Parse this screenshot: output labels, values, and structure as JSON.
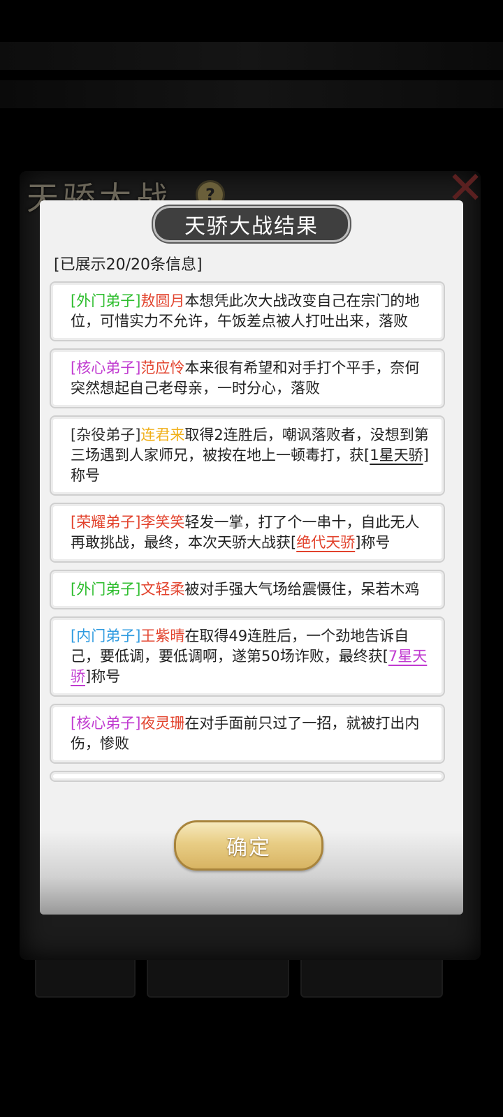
{
  "background": {
    "panel_title": "天骄大战"
  },
  "dialog": {
    "title": "天骄大战结果",
    "info_count": "[已展示20/20条信息]",
    "confirm_label": "确定"
  },
  "colors": {
    "outer_disciple": "#2dbd2d",
    "core_disciple": "#c03ad0",
    "servant_disciple": "#333333",
    "glory_disciple": "#e2422c",
    "inner_disciple": "#2f9be0",
    "name_red": "#e2422c",
    "name_yellow": "#f0b01a",
    "title_purple": "#c03ad0",
    "title_red": "#e2422c",
    "title_dark": "#222222"
  },
  "results": [
    {
      "rank": "[外门弟子]",
      "rank_color": "#2dbd2d",
      "name": "敖圆月",
      "name_color": "#e2422c",
      "text": "本想凭此次大战改变自己在宗门的地位，可惜实力不允许，午饭差点被人打吐出来，落败",
      "title_prefix": "",
      "title": "",
      "title_color": "",
      "suffix": ""
    },
    {
      "rank": "[核心弟子]",
      "rank_color": "#c03ad0",
      "name": "范应怜",
      "name_color": "#e2422c",
      "text": "本来很有希望和对手打个平手，奈何突然想起自己老母亲，一时分心，落败",
      "title_prefix": "",
      "title": "",
      "title_color": "",
      "suffix": ""
    },
    {
      "rank": "[杂役弟子]",
      "rank_color": "#333333",
      "name": "连君来",
      "name_color": "#f0b01a",
      "text": "取得2连胜后，嘲讽落败者，没想到第三场遇到人家师兄，被按在地上一顿毒打，获[",
      "title_prefix": "",
      "title": "1星天骄",
      "title_color": "#222222",
      "suffix": "]称号"
    },
    {
      "rank": "[荣耀弟子]",
      "rank_color": "#e2422c",
      "name": "李笑笑",
      "name_color": "#e2422c",
      "text": "轻发一掌，打了个一串十，自此无人再敢挑战，最终，本次天骄大战获[",
      "title_prefix": "",
      "title": "绝代天骄",
      "title_color": "#e2422c",
      "suffix": "]称号"
    },
    {
      "rank": "[外门弟子]",
      "rank_color": "#2dbd2d",
      "name": "文轻柔",
      "name_color": "#e2422c",
      "text": "被对手强大气场给震慑住，呆若木鸡",
      "title_prefix": "",
      "title": "",
      "title_color": "",
      "suffix": ""
    },
    {
      "rank": "[内门弟子]",
      "rank_color": "#2f9be0",
      "name": "王紫晴",
      "name_color": "#e2422c",
      "text": "在取得49连胜后，一个劲地告诉自己，要低调，要低调啊，遂第50场诈败，最终获[",
      "title_prefix": "",
      "title": "7星天骄",
      "title_color": "#c03ad0",
      "suffix": "]称号"
    },
    {
      "rank": "[核心弟子]",
      "rank_color": "#c03ad0",
      "name": "夜灵珊",
      "name_color": "#e2422c",
      "text": "在对手面前只过了一招，就被打出内伤，惨败",
      "title_prefix": "",
      "title": "",
      "title_color": "",
      "suffix": ""
    }
  ]
}
